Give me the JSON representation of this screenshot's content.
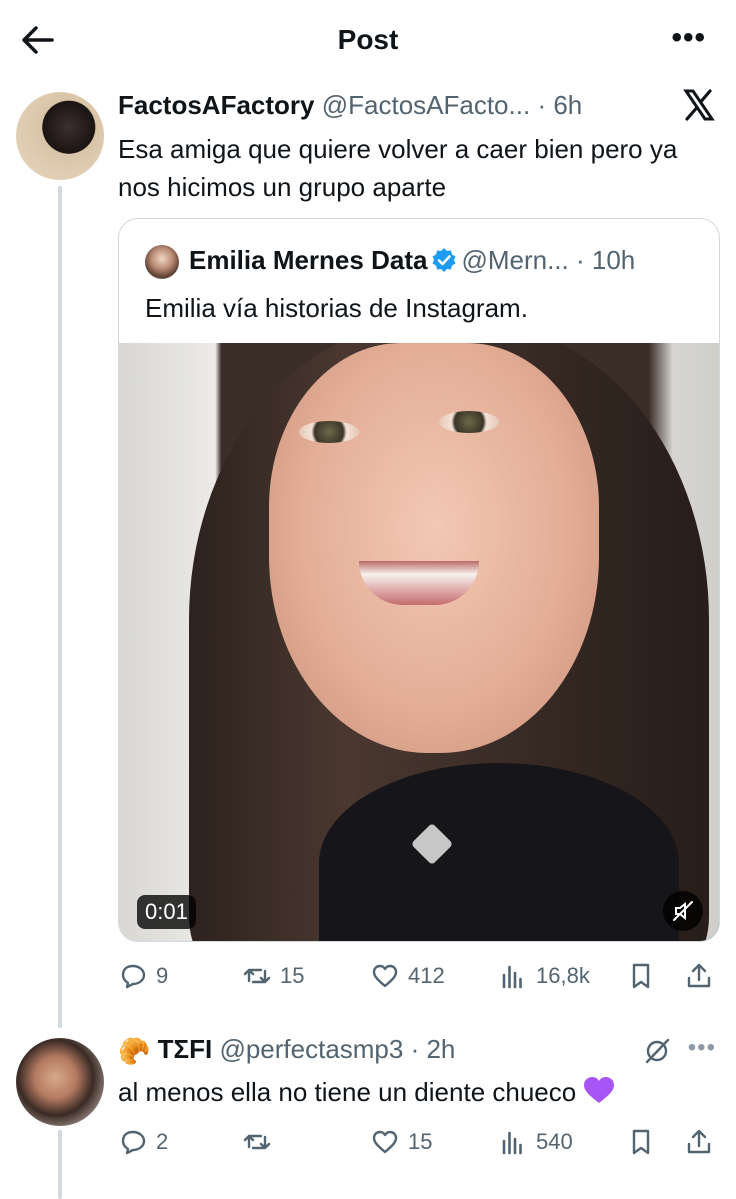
{
  "header": {
    "title": "Post",
    "more": "•••"
  },
  "post": {
    "author_name": "FactosAFactory",
    "author_handle": "@FactosAFacto...",
    "time": "· 6h",
    "text": "Esa amiga que quiere volver a caer bien pero ya nos hicimos un grupo aparte",
    "quote": {
      "author_name": "Emilia Mernes Data",
      "author_handle": "@Mern...",
      "time": "· 10h",
      "text": "Emilia vía historias de Instagram.",
      "video_time": "0:01"
    },
    "stats": {
      "replies": "9",
      "reposts": "15",
      "likes": "412",
      "views": "16,8k"
    }
  },
  "reply": {
    "author_emoji": "🥐",
    "author_name": "TΣFI",
    "author_handle": "@perfectasmp3",
    "time": "· 2h",
    "text": "al menos ella no tiene un diente chueco",
    "more": "•••",
    "stats": {
      "replies": "2",
      "reposts": "",
      "likes": "15",
      "views": "540"
    }
  },
  "colors": {
    "text": "#0f1419",
    "secondary": "#536471",
    "border": "#cfd9de",
    "verified": "#1d9bf0",
    "purple_heart": "#a855f7"
  }
}
